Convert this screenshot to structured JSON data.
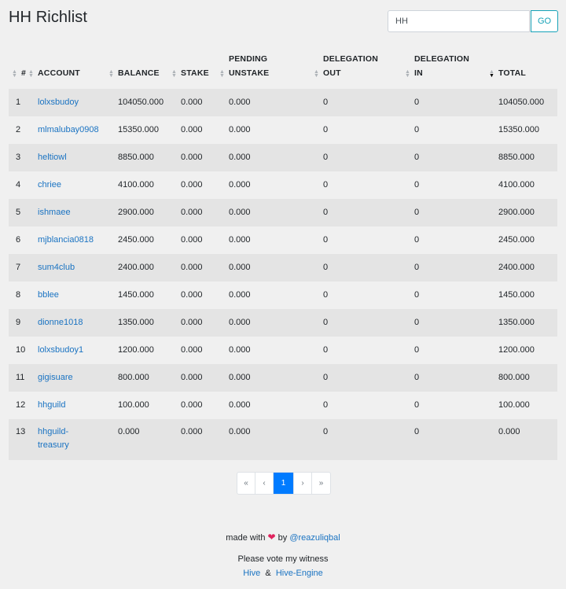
{
  "header": {
    "title": "HH Richlist"
  },
  "search": {
    "value": "HH",
    "button_label": "GO"
  },
  "table": {
    "columns": [
      {
        "key": "rank",
        "lines": [
          "#"
        ]
      },
      {
        "key": "account",
        "lines": [
          "ACCOUNT"
        ]
      },
      {
        "key": "balance",
        "lines": [
          "BALANCE"
        ]
      },
      {
        "key": "stake",
        "lines": [
          "STAKE"
        ]
      },
      {
        "key": "pending_unstake",
        "lines": [
          "PENDING",
          "UNSTAKE"
        ]
      },
      {
        "key": "delegation_out",
        "lines": [
          "DELEGATION",
          "OUT"
        ]
      },
      {
        "key": "delegation_in",
        "lines": [
          "DELEGATION",
          "IN"
        ]
      },
      {
        "key": "total",
        "lines": [
          "TOTAL"
        ]
      }
    ],
    "sorted_column": "total",
    "rows": [
      {
        "rank": "1",
        "account": "lolxsbudoy",
        "balance": "104050.000",
        "stake": "0.000",
        "pending_unstake": "0.000",
        "delegation_out": "0",
        "delegation_in": "0",
        "total": "104050.000"
      },
      {
        "rank": "2",
        "account": "mlmalubay0908",
        "balance": "15350.000",
        "stake": "0.000",
        "pending_unstake": "0.000",
        "delegation_out": "0",
        "delegation_in": "0",
        "total": "15350.000"
      },
      {
        "rank": "3",
        "account": "heltiowl",
        "balance": "8850.000",
        "stake": "0.000",
        "pending_unstake": "0.000",
        "delegation_out": "0",
        "delegation_in": "0",
        "total": "8850.000"
      },
      {
        "rank": "4",
        "account": "chriee",
        "balance": "4100.000",
        "stake": "0.000",
        "pending_unstake": "0.000",
        "delegation_out": "0",
        "delegation_in": "0",
        "total": "4100.000"
      },
      {
        "rank": "5",
        "account": "ishmaee",
        "balance": "2900.000",
        "stake": "0.000",
        "pending_unstake": "0.000",
        "delegation_out": "0",
        "delegation_in": "0",
        "total": "2900.000"
      },
      {
        "rank": "6",
        "account": "mjblancia0818",
        "balance": "2450.000",
        "stake": "0.000",
        "pending_unstake": "0.000",
        "delegation_out": "0",
        "delegation_in": "0",
        "total": "2450.000"
      },
      {
        "rank": "7",
        "account": "sum4club",
        "balance": "2400.000",
        "stake": "0.000",
        "pending_unstake": "0.000",
        "delegation_out": "0",
        "delegation_in": "0",
        "total": "2400.000"
      },
      {
        "rank": "8",
        "account": "bblee",
        "balance": "1450.000",
        "stake": "0.000",
        "pending_unstake": "0.000",
        "delegation_out": "0",
        "delegation_in": "0",
        "total": "1450.000"
      },
      {
        "rank": "9",
        "account": "dionne1018",
        "balance": "1350.000",
        "stake": "0.000",
        "pending_unstake": "0.000",
        "delegation_out": "0",
        "delegation_in": "0",
        "total": "1350.000"
      },
      {
        "rank": "10",
        "account": "lolxsbudoy1",
        "balance": "1200.000",
        "stake": "0.000",
        "pending_unstake": "0.000",
        "delegation_out": "0",
        "delegation_in": "0",
        "total": "1200.000"
      },
      {
        "rank": "11",
        "account": "gigisuare",
        "balance": "800.000",
        "stake": "0.000",
        "pending_unstake": "0.000",
        "delegation_out": "0",
        "delegation_in": "0",
        "total": "800.000"
      },
      {
        "rank": "12",
        "account": "hhguild",
        "balance": "100.000",
        "stake": "0.000",
        "pending_unstake": "0.000",
        "delegation_out": "0",
        "delegation_in": "0",
        "total": "100.000"
      },
      {
        "rank": "13",
        "account": "hhguild-treasury",
        "balance": "0.000",
        "stake": "0.000",
        "pending_unstake": "0.000",
        "delegation_out": "0",
        "delegation_in": "0",
        "total": "0.000"
      }
    ]
  },
  "pagination": {
    "first": "«",
    "prev": "‹",
    "current": "1",
    "next": "›",
    "last": "»"
  },
  "footer": {
    "made_with": "made with",
    "heart": "❤",
    "by": "by",
    "author": "@reazuliqbal",
    "vote_text": "Please vote my witness",
    "link_hive": "Hive",
    "amp": "&",
    "link_engine": "Hive-Engine"
  },
  "colors": {
    "link": "#1a73c2",
    "accent": "#007bff",
    "go_button": "#17a2b8",
    "row_stripe": "#e4e4e4"
  }
}
